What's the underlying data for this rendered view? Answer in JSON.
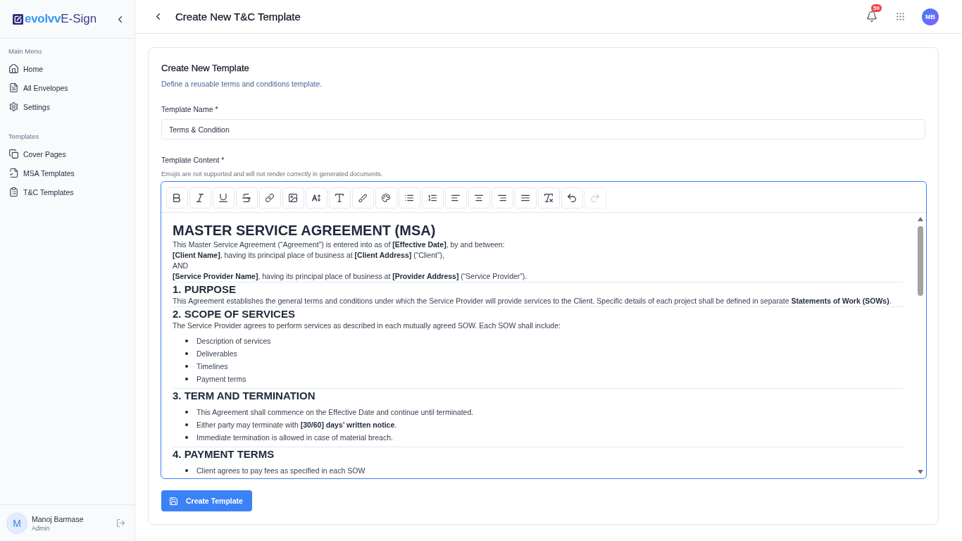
{
  "sidebar": {
    "logo": {
      "brand": "evolvv",
      "product": "E-Sign"
    },
    "sections": [
      {
        "title": "Main Menu",
        "items": [
          "Home",
          "All Envelopes",
          "Settings"
        ]
      },
      {
        "title": "Templates",
        "items": [
          "Cover Pages",
          "MSA Templates",
          "T&C Templates"
        ]
      }
    ],
    "user": {
      "initial": "M",
      "name": "Manoj Barmase",
      "role": "Admin"
    }
  },
  "header": {
    "title": "Create New T&C Template",
    "notification_count": "50",
    "avatar": "MB"
  },
  "form": {
    "title": "Create New Template",
    "subtitle": "Define a reusable terms and conditions template.",
    "name_field": {
      "label": "Template Name *",
      "value": "Terms & Condition"
    },
    "content_field": {
      "label": "Template Content *",
      "hint": "Emojis are not supported and will not render correctly in generated documents.",
      "toolbar": [
        {
          "kind": "bold",
          "disabled": false
        },
        {
          "kind": "italic",
          "disabled": false
        },
        {
          "kind": "underline",
          "disabled": false
        },
        {
          "kind": "strikethrough",
          "disabled": false
        },
        {
          "kind": "link",
          "disabled": false
        },
        {
          "kind": "image",
          "disabled": false
        },
        {
          "kind": "font_size",
          "disabled": false
        },
        {
          "kind": "text_style",
          "disabled": false
        },
        {
          "kind": "brush",
          "disabled": false
        },
        {
          "kind": "palette",
          "disabled": false
        },
        {
          "kind": "bullet_list",
          "disabled": false
        },
        {
          "kind": "ordered_list",
          "disabled": false
        },
        {
          "kind": "align_left",
          "disabled": false
        },
        {
          "kind": "align_center",
          "disabled": false
        },
        {
          "kind": "align_right",
          "disabled": false
        },
        {
          "kind": "justify",
          "disabled": false
        },
        {
          "kind": "clear_format",
          "disabled": false
        },
        {
          "kind": "undo",
          "disabled": false
        },
        {
          "kind": "redo",
          "disabled": true
        }
      ],
      "document": [
        {
          "kind": "title",
          "text": "MASTER SERVICE AGREEMENT (MSA)"
        },
        {
          "kind": "paragraph",
          "text": "This Master Service Agreement (“Agreement”) is entered into as of **[Effective Date]**, by and between:"
        },
        {
          "kind": "paragraph",
          "text": "**[Client Name]**, having its principal place of business at **[Client Address]** (“Client”),"
        },
        {
          "kind": "paragraph",
          "text": "AND"
        },
        {
          "kind": "paragraph",
          "text": "**[Service Provider Name]**, having its principal place of business at **[Provider Address]** (“Service Provider”)."
        },
        {
          "kind": "heading",
          "text": "1. PURPOSE"
        },
        {
          "kind": "paragraph",
          "text": "This Agreement establishes the general terms and conditions under which the Service Provider will provide services to the Client. Specific details of each project shall be defined in separate **Statements of Work (SOWs)**."
        },
        {
          "kind": "heading",
          "text": "2. SCOPE OF SERVICES"
        },
        {
          "kind": "paragraph",
          "text": "The Service Provider agrees to perform services as described in each mutually agreed SOW. Each SOW shall include:"
        },
        {
          "kind": "list",
          "items": [
            "Description of services",
            "Deliverables",
            "Timelines",
            "Payment terms"
          ]
        },
        {
          "kind": "heading",
          "text": "3. TERM AND TERMINATION"
        },
        {
          "kind": "list",
          "items": [
            "This Agreement shall commence on the Effective Date and continue until terminated.",
            "Either party may terminate with **[30/60] days’ written notice**.",
            "Immediate termination is allowed in case of material breach."
          ]
        },
        {
          "kind": "heading",
          "text": "4. PAYMENT TERMS"
        },
        {
          "kind": "list",
          "items": [
            "Client agrees to pay fees as specified in each SOW"
          ]
        }
      ]
    },
    "submit": "Create Template"
  }
}
